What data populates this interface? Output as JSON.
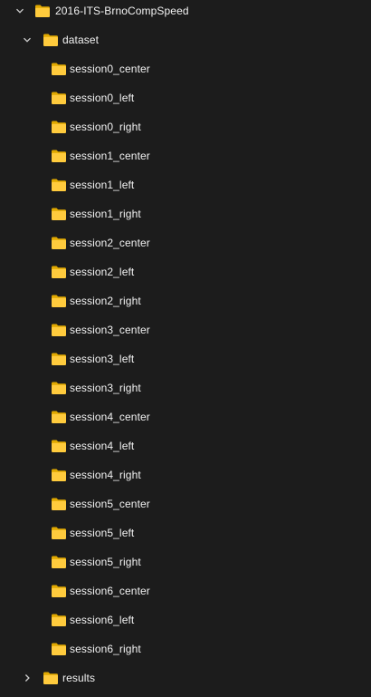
{
  "tree": {
    "root": {
      "label": "2016-ITS-BrnoCompSpeed",
      "expanded": true,
      "icon": "folder-icon",
      "chevron_icon": "chevron-down-icon"
    },
    "dataset": {
      "label": "dataset",
      "expanded": true,
      "icon": "folder-icon",
      "chevron_icon": "chevron-down-icon"
    },
    "sessions": [
      "session0_center",
      "session0_left",
      "session0_right",
      "session1_center",
      "session1_left",
      "session1_right",
      "session2_center",
      "session2_left",
      "session2_right",
      "session3_center",
      "session3_left",
      "session3_right",
      "session4_center",
      "session4_left",
      "session4_right",
      "session5_center",
      "session5_left",
      "session5_right",
      "session6_center",
      "session6_left",
      "session6_right"
    ],
    "results": {
      "label": "results",
      "expanded": false,
      "icon": "folder-icon",
      "chevron_icon": "chevron-right-icon"
    }
  },
  "colors": {
    "background": "#1c1c1c",
    "text": "#f2f2f2",
    "chevron": "#cfcfcf",
    "folder_back": "#e0a800",
    "folder_front": "#ffcb3d"
  }
}
